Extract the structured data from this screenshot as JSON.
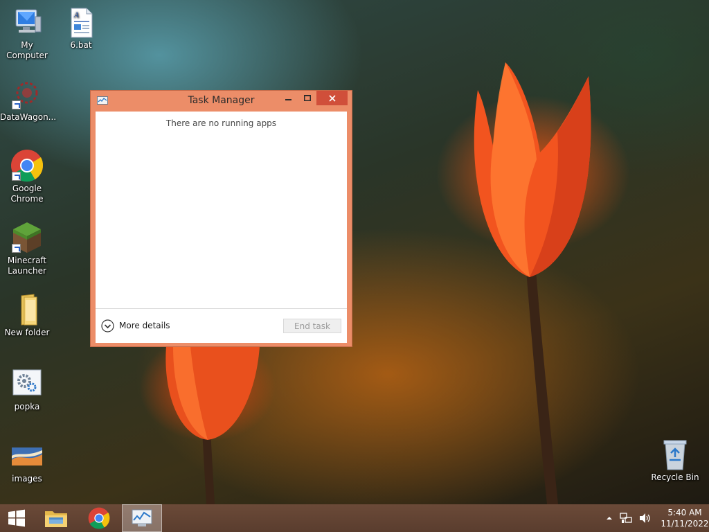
{
  "desktop": {
    "icons": [
      {
        "name": "my-computer-icon",
        "label": "My Computer"
      },
      {
        "name": "bat-file-icon",
        "label": "6.bat"
      },
      {
        "name": "datawagon-icon",
        "label": "DataWagon..."
      },
      {
        "name": "chrome-icon",
        "label": "Google Chrome"
      },
      {
        "name": "minecraft-icon",
        "label": "Minecraft Launcher"
      },
      {
        "name": "folder-icon",
        "label": "New folder"
      },
      {
        "name": "popka-icon",
        "label": "popka"
      },
      {
        "name": "images-icon",
        "label": "images"
      },
      {
        "name": "recycle-bin-icon",
        "label": "Recycle Bin"
      }
    ]
  },
  "task_manager": {
    "title": "Task Manager",
    "empty_message": "There are no running apps",
    "more_details_label": "More details",
    "end_task_label": "End task"
  },
  "taskbar": {
    "clock_time": "5:40 AM",
    "clock_date": "11/11/2022"
  },
  "colors": {
    "window_frame": "#ec8d68",
    "close_button": "#d04f3a",
    "taskbar": "#5a3d2e"
  }
}
